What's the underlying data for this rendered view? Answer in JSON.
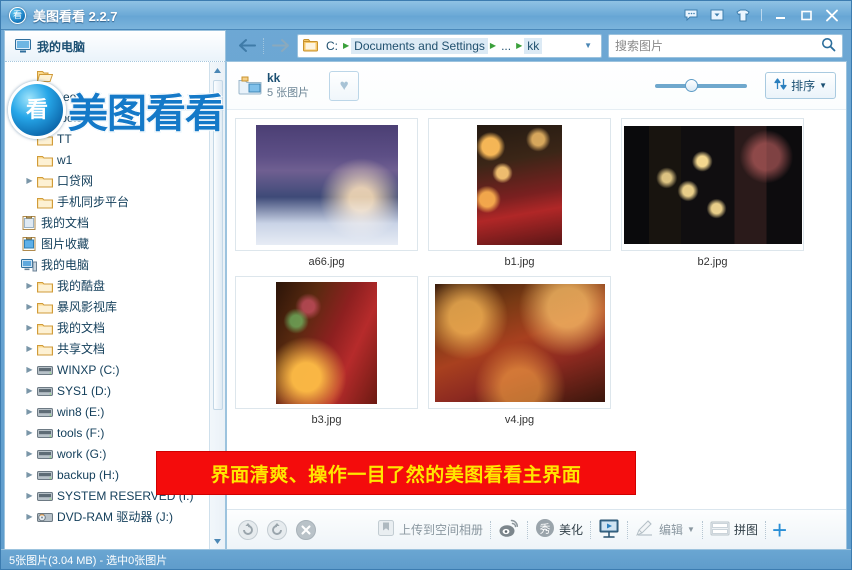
{
  "window": {
    "title": "美图看看 2.2.7",
    "logo_glyph": "看",
    "controls": {
      "feedback": "message-icon",
      "dropdown": "dropdown-icon",
      "skin": "skin-icon",
      "minimize": "minimize-icon",
      "maximize": "maximize-icon",
      "close": "close-icon"
    }
  },
  "sidebar": {
    "header": "我的电脑",
    "items": [
      {
        "label": "",
        "indent": 2,
        "icon": "open-folder-icon",
        "arrow": false
      },
      {
        "label": "seo",
        "indent": 2,
        "icon": "folder-icon",
        "arrow": false
      },
      {
        "label": "tools",
        "indent": 2,
        "icon": "folder-icon",
        "arrow": true
      },
      {
        "label": "TT",
        "indent": 2,
        "icon": "folder-icon",
        "arrow": false
      },
      {
        "label": "w1",
        "indent": 2,
        "icon": "folder-icon",
        "arrow": false
      },
      {
        "label": "口贷网",
        "indent": 2,
        "icon": "folder-icon",
        "arrow": true
      },
      {
        "label": "手机同步平台",
        "indent": 2,
        "icon": "folder-icon",
        "arrow": false
      },
      {
        "label": "我的文档",
        "indent": 1,
        "icon": "documents-icon",
        "arrow": false
      },
      {
        "label": "图片收藏",
        "indent": 1,
        "icon": "pictures-icon",
        "arrow": false
      },
      {
        "label": "我的电脑",
        "indent": 1,
        "icon": "computer-icon",
        "arrow": false
      },
      {
        "label": "我的酷盘",
        "indent": 2,
        "icon": "folder-icon",
        "arrow": true
      },
      {
        "label": "暴风影视库",
        "indent": 2,
        "icon": "folder-icon",
        "arrow": true
      },
      {
        "label": "我的文档",
        "indent": 2,
        "icon": "folder-icon",
        "arrow": true
      },
      {
        "label": "共享文档",
        "indent": 2,
        "icon": "folder-icon",
        "arrow": true
      },
      {
        "label": "WINXP (C:)",
        "indent": 2,
        "icon": "drive-icon",
        "arrow": true
      },
      {
        "label": "SYS1 (D:)",
        "indent": 2,
        "icon": "drive-icon",
        "arrow": true
      },
      {
        "label": "win8 (E:)",
        "indent": 2,
        "icon": "drive-icon",
        "arrow": true
      },
      {
        "label": "tools (F:)",
        "indent": 2,
        "icon": "drive-icon",
        "arrow": true
      },
      {
        "label": "work (G:)",
        "indent": 2,
        "icon": "drive-icon",
        "arrow": true
      },
      {
        "label": "backup (H:)",
        "indent": 2,
        "icon": "drive-icon",
        "arrow": true
      },
      {
        "label": "SYSTEM RESERVED (I:)",
        "indent": 2,
        "icon": "drive-icon",
        "arrow": true
      },
      {
        "label": "DVD-RAM 驱动器 (J:)",
        "indent": 2,
        "icon": "dvd-icon",
        "arrow": true
      }
    ],
    "scroll_up": "▲",
    "scroll_down": "▼"
  },
  "watermark": {
    "ball_glyph": "看",
    "text": "美图看看"
  },
  "nav": {
    "back": "back-arrow-icon",
    "forward": "forward-arrow-icon",
    "breadcrumb": [
      "C:",
      "Documents and Settings",
      "...",
      "kk"
    ],
    "breadcrumb_caret": "▼"
  },
  "search": {
    "placeholder": "搜索图片",
    "value": "",
    "icon": "search-icon"
  },
  "folderbar": {
    "name": "kk",
    "count": "5 张图片",
    "favorite_icon": "heart-icon",
    "sort_label": "排序",
    "sort_caret": "▼",
    "zoom_value": 35
  },
  "thumbnails": [
    {
      "name": "a66.jpg",
      "scene": "winter-mill"
    },
    {
      "name": "b1.jpg",
      "scene": "couple-bokeh"
    },
    {
      "name": "b2.jpg",
      "scene": "couple-lights"
    },
    {
      "name": "b3.jpg",
      "scene": "couple-santa"
    },
    {
      "name": "v4.jpg",
      "scene": "couple-hug"
    }
  ],
  "banner": {
    "text": "界面清爽、操作一目了然的美图看看主界面",
    "bg_color": "#f40c0c",
    "text_color": "#ffe600"
  },
  "bottombar": {
    "rotate_left": "rotate-left-icon",
    "rotate_right": "rotate-right-icon",
    "delete": "delete-icon",
    "items": [
      {
        "label": "上传到空间相册",
        "icon": "upload-icon",
        "caret": ""
      },
      {
        "label": "",
        "icon": "weibo-icon",
        "caret": ""
      },
      {
        "label": "美化",
        "icon": "beautify-icon",
        "caret": ""
      },
      {
        "label": "",
        "icon": "slideshow-icon",
        "caret": ""
      },
      {
        "label": "编辑",
        "icon": "edit-icon",
        "caret": "▼"
      },
      {
        "label": "拼图",
        "icon": "collage-icon",
        "caret": ""
      }
    ],
    "add": "plus-icon"
  },
  "statusbar": {
    "text": "5张图片(3.04 MB) - 选中0张图片"
  }
}
